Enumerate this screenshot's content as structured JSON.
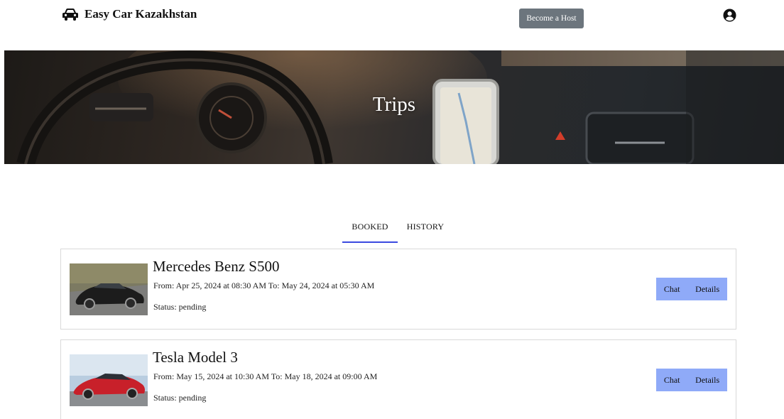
{
  "header": {
    "brand": "Easy Car Kazakhstan",
    "host_button": "Become a Host",
    "brand_icon": "car-icon",
    "profile_icon": "user-circle-icon"
  },
  "hero": {
    "title": "Trips"
  },
  "tabs": [
    {
      "label": "BOOKED",
      "active": true
    },
    {
      "label": "HISTORY",
      "active": false
    }
  ],
  "trips": [
    {
      "car": "Mercedes Benz S500",
      "dates": "From: Apr 25, 2024 at 08:30 AM To: May 24, 2024 at 05:30 AM",
      "status": "Status: pending",
      "chat": "Chat",
      "details": "Details"
    },
    {
      "car": "Tesla Model 3",
      "dates": "From: May 15, 2024 at 10:30 AM To: May 18, 2024 at 09:00 AM",
      "status": "Status: pending",
      "chat": "Chat",
      "details": "Details"
    }
  ],
  "colors": {
    "host_button_bg": "#6c757d",
    "tab_underline": "#3b4ae0",
    "action_bg": "#8faaf8"
  }
}
